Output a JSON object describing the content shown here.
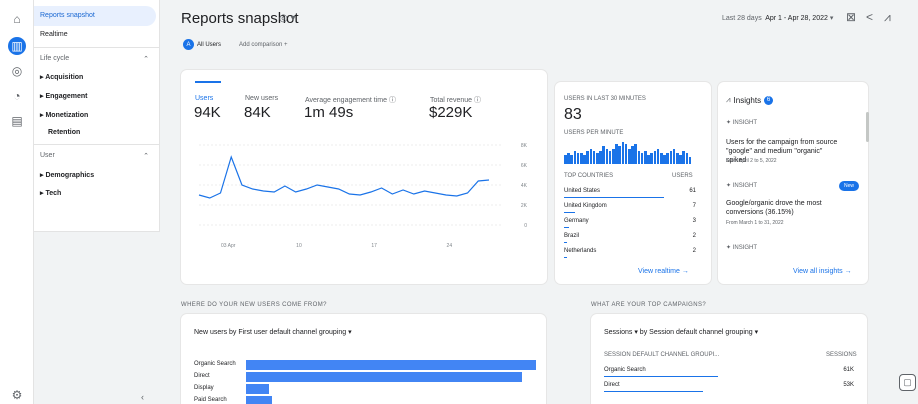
{
  "rail": {
    "icons": [
      "home-icon",
      "reports-icon",
      "explore-icon",
      "advertising-icon",
      "configure-icon"
    ]
  },
  "sidebar": {
    "snapshot": "Reports snapshot",
    "realtime": "Realtime",
    "lifecycle_group": "Life cycle",
    "acquisition": "Acquisition",
    "engagement": "Engagement",
    "monetization": "Monetization",
    "retention": "Retention",
    "user_group": "User",
    "demographics": "Demographics",
    "tech": "Tech"
  },
  "header": {
    "title": "Reports snapshot",
    "date_prefix": "Last 28 days",
    "date_range": "Apr 1 - Apr 28, 2022",
    "chip_all_users": "All Users",
    "add_comparison": "Add comparison +"
  },
  "metrics": [
    {
      "label": "Users",
      "value": "94K"
    },
    {
      "label": "New users",
      "value": "84K"
    },
    {
      "label": "Average engagement time",
      "value": "1m 49s"
    },
    {
      "label": "Total revenue",
      "value": "$229K"
    }
  ],
  "chart_data": {
    "type": "line",
    "series": [
      {
        "values": [
          3.0,
          2.7,
          3.2,
          6.8,
          4.0,
          3.6,
          3.4,
          3.3,
          3.9,
          3.3,
          3.6,
          4.0,
          3.8,
          3.6,
          3.1,
          3.0,
          3.3,
          3.7,
          3.1,
          3.5,
          3.1,
          3.4,
          3.2,
          3.0,
          2.9,
          3.2,
          4.4,
          4.5
        ]
      }
    ],
    "x_ticks": [
      "03 Apr",
      "10",
      "17",
      "24"
    ],
    "y_ticks": [
      "8K",
      "6K",
      "4K",
      "2K",
      "0"
    ],
    "ylim": [
      0,
      8
    ]
  },
  "realtime": {
    "title": "USERS IN LAST 30 MINUTES",
    "value": "83",
    "per_minute": "USERS PER MINUTE",
    "col_country": "TOP COUNTRIES",
    "col_users": "USERS",
    "rows": [
      {
        "country": "United States",
        "users": "61"
      },
      {
        "country": "United Kingdom",
        "users": "7"
      },
      {
        "country": "Germany",
        "users": "3"
      },
      {
        "country": "Brazil",
        "users": "2"
      },
      {
        "country": "Netherlands",
        "users": "2"
      }
    ],
    "bar_values": [
      4,
      5,
      4,
      6,
      5,
      5,
      4,
      6,
      7,
      6,
      5,
      6,
      8,
      7,
      6,
      7,
      9,
      8,
      10,
      9,
      7,
      8,
      9,
      6,
      5,
      6,
      4,
      5,
      6,
      7,
      5,
      4,
      5,
      6,
      7,
      5,
      4,
      6,
      5,
      3
    ],
    "view_link": "View realtime →"
  },
  "insights": {
    "title": "Insights",
    "count": "6",
    "items": [
      {
        "tag": "INSIGHT",
        "text": "Users for the campaign from source \"google\" and medium \"organic\" spiked",
        "date": "From April 2 to 5, 2022"
      },
      {
        "tag": "INSIGHT",
        "badge": "New",
        "text": "Google/organic drove the most conversions (36.15%)",
        "date": "From March 1 to 31, 2022"
      },
      {
        "tag": "INSIGHT"
      }
    ],
    "view_all": "View all insights →"
  },
  "new_users": {
    "title": "WHERE DO YOUR NEW USERS COME FROM?",
    "dropdown": "New users by First user default channel grouping ▾",
    "rows": [
      {
        "label": "Organic Search",
        "value": 100
      },
      {
        "label": "Direct",
        "value": 95
      },
      {
        "label": "Display",
        "value": 8
      },
      {
        "label": "Paid Search",
        "value": 9
      }
    ]
  },
  "campaigns": {
    "title": "WHAT ARE YOUR TOP CAMPAIGNS?",
    "dropdown": "Sessions ▾ by Session default channel grouping ▾",
    "col_channel": "SESSION DEFAULT CHANNEL GROUPI...",
    "col_sessions": "SESSIONS",
    "rows": [
      {
        "label": "Organic Search",
        "value": "61K"
      },
      {
        "label": "Direct",
        "value": "53K"
      }
    ]
  }
}
